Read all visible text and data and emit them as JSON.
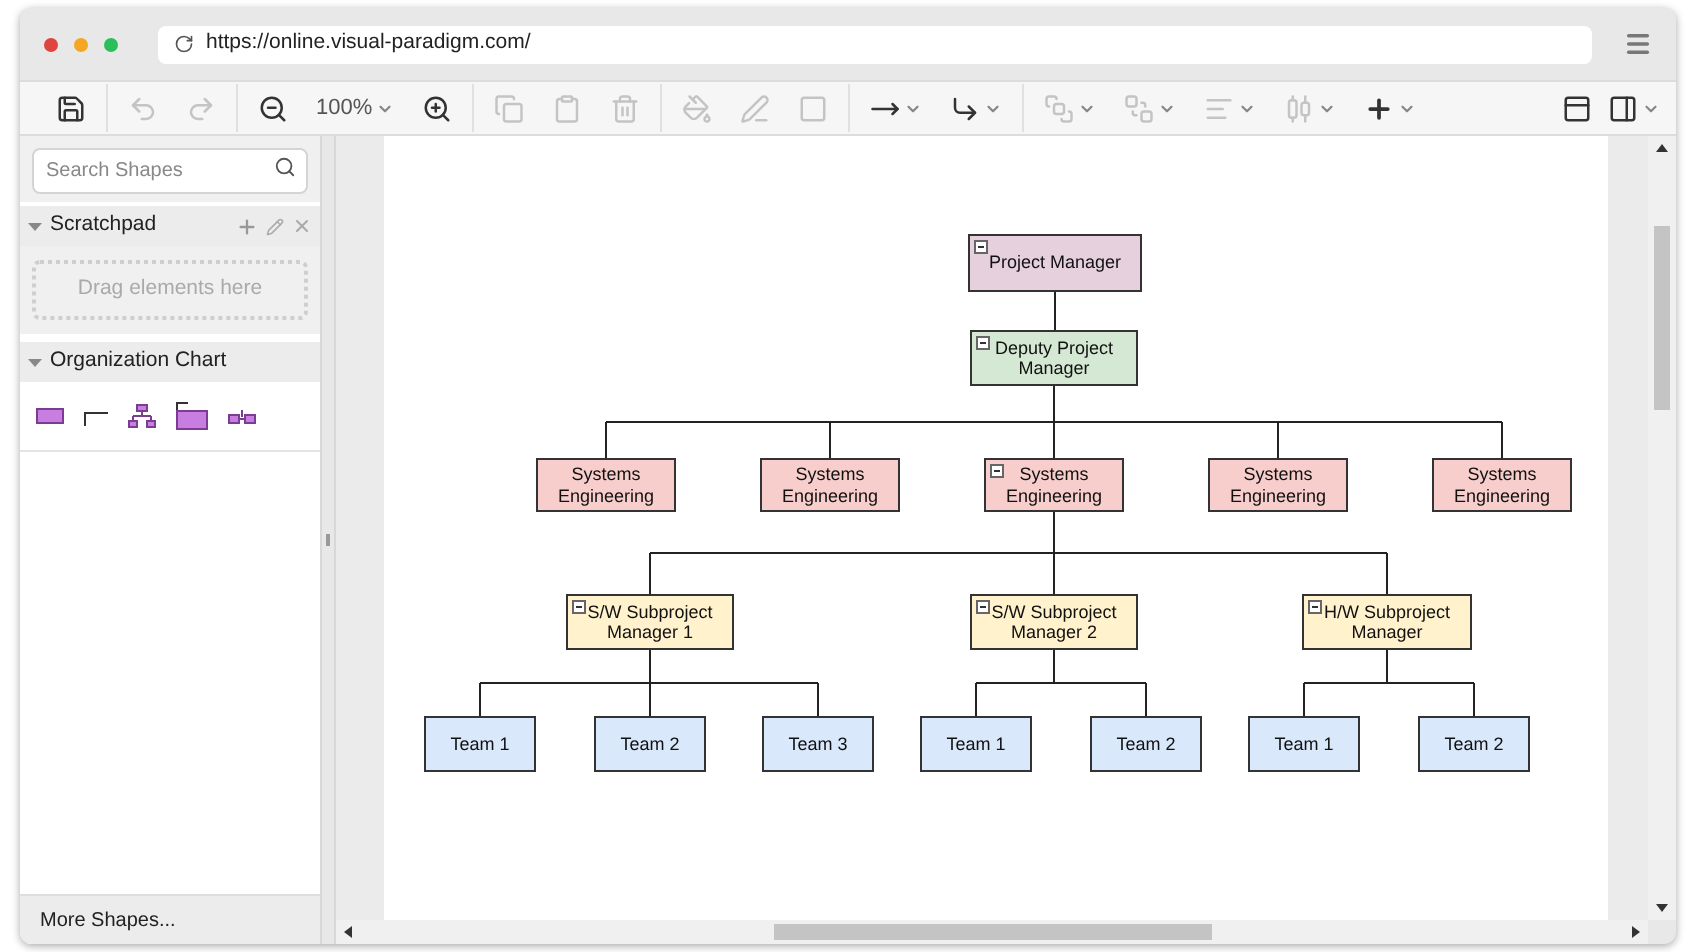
{
  "browser": {
    "url": "https://online.visual-paradigm.com/"
  },
  "toolbar": {
    "groups": [
      [
        {
          "kind": "save",
          "disabled": false,
          "menu": false
        }
      ],
      [
        {
          "kind": "undo",
          "disabled": true,
          "menu": false
        },
        {
          "kind": "redo",
          "disabled": true,
          "menu": false
        }
      ],
      [
        {
          "kind": "zoom-out",
          "disabled": false,
          "menu": false
        },
        {
          "kind": "zoom-level",
          "label": "100%",
          "disabled": false,
          "menu": true
        },
        {
          "kind": "zoom-in",
          "disabled": false,
          "menu": false
        }
      ],
      [
        {
          "kind": "copy",
          "disabled": true,
          "menu": false
        },
        {
          "kind": "paste",
          "disabled": true,
          "menu": false
        },
        {
          "kind": "delete",
          "disabled": true,
          "menu": false
        }
      ],
      [
        {
          "kind": "fill",
          "disabled": true,
          "menu": false
        },
        {
          "kind": "line",
          "disabled": true,
          "menu": false
        },
        {
          "kind": "shadow",
          "disabled": true,
          "menu": false
        }
      ],
      [
        {
          "kind": "connector",
          "disabled": false,
          "menu": true
        },
        {
          "kind": "waypoint",
          "disabled": false,
          "menu": true
        }
      ],
      [
        {
          "kind": "front",
          "disabled": true,
          "menu": true
        },
        {
          "kind": "back",
          "disabled": true,
          "menu": true
        },
        {
          "kind": "align",
          "disabled": true,
          "menu": true
        },
        {
          "kind": "distribute",
          "disabled": true,
          "menu": true
        },
        {
          "kind": "insert",
          "disabled": false,
          "menu": true
        }
      ]
    ],
    "right": [
      {
        "kind": "format",
        "disabled": false,
        "menu": false
      },
      {
        "kind": "layout",
        "disabled": false,
        "menu": true
      }
    ]
  },
  "sidebar": {
    "search": {
      "placeholder": "Search Shapes"
    },
    "scratchpad": {
      "title": "Scratchpad",
      "expanded": true,
      "drop_hint": "Drag elements here"
    },
    "library": {
      "title": "Organization Chart",
      "expanded": true,
      "shapes": [
        {
          "kind": "box"
        },
        {
          "kind": "elbow"
        },
        {
          "kind": "tree"
        },
        {
          "kind": "container"
        },
        {
          "kind": "branch"
        }
      ]
    },
    "more": "More Shapes..."
  },
  "diagram": {
    "root": {
      "label": "Project Manager",
      "color": "#e6d0de",
      "collapsible": true,
      "children": [
        {
          "label": "Deputy Project Manager",
          "color": "#d5e8d4",
          "collapsible": true,
          "children": [
            {
              "label": "Systems Engineering",
              "color": "#f8cecc",
              "collapsible": false
            },
            {
              "label": "Systems Engineering",
              "color": "#f8cecc",
              "collapsible": false
            },
            {
              "label": "Systems Engineering",
              "color": "#f8cecc",
              "collapsible": true,
              "children": [
                {
                  "label": "S/W Subproject Manager 1",
                  "color": "#fff2cc",
                  "collapsible": true,
                  "children": [
                    {
                      "label": "Team 1",
                      "color": "#dae8fc",
                      "collapsible": false
                    },
                    {
                      "label": "Team 2",
                      "color": "#dae8fc",
                      "collapsible": false
                    },
                    {
                      "label": "Team 3",
                      "color": "#dae8fc",
                      "collapsible": false
                    }
                  ]
                },
                {
                  "label": "S/W Subproject Manager 2",
                  "color": "#fff2cc",
                  "collapsible": true,
                  "children": [
                    {
                      "label": "Team 1",
                      "color": "#dae8fc",
                      "collapsible": false
                    },
                    {
                      "label": "Team 2",
                      "color": "#dae8fc",
                      "collapsible": false
                    }
                  ]
                },
                {
                  "label": "H/W Subproject Manager",
                  "color": "#fff2cc",
                  "collapsible": true,
                  "children": [
                    {
                      "label": "Team 1",
                      "color": "#dae8fc",
                      "collapsible": false
                    },
                    {
                      "label": "Team 2",
                      "color": "#dae8fc",
                      "collapsible": false
                    }
                  ]
                }
              ]
            },
            {
              "label": "Systems Engineering",
              "color": "#f8cecc",
              "collapsible": false
            },
            {
              "label": "Systems Engineering",
              "color": "#f8cecc",
              "collapsible": false
            }
          ]
        }
      ]
    }
  }
}
